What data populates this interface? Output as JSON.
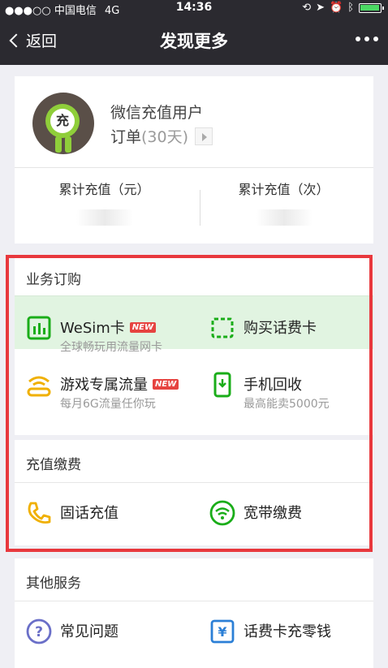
{
  "status_bar": {
    "carrier": "●●●○○ 中国电信",
    "network": "4G",
    "time": "14:36"
  },
  "nav": {
    "back_label": "返回",
    "title": "发现更多"
  },
  "profile": {
    "avatar_char": "充",
    "name": "微信充值用户",
    "order_label": "订单",
    "order_days": "(30天)",
    "stat_amount_label": "累计充值（元）",
    "stat_count_label": "累计充值（次）"
  },
  "sections": {
    "business": {
      "title": "业务订购",
      "items": [
        {
          "label": "WeSim卡",
          "badge": "NEW",
          "sub": "全球畅玩用流量网卡",
          "icon": "bar-chart-icon",
          "color": "#1aad19"
        },
        {
          "label": "购买话费卡",
          "sub": "",
          "icon": "card-icon",
          "color": "#1aad19"
        },
        {
          "label": "游戏专属流量",
          "badge": "NEW",
          "sub": "每月6G流量任你玩",
          "icon": "game-pad-icon",
          "color": "#f0b000"
        },
        {
          "label": "手机回收",
          "sub": "最高能卖5000元",
          "icon": "phone-recycle-icon",
          "color": "#1aad19"
        }
      ]
    },
    "recharge": {
      "title": "充值缴费",
      "items": [
        {
          "label": "固话充值",
          "icon": "telephone-icon",
          "color": "#f0b000"
        },
        {
          "label": "宽带缴费",
          "icon": "wifi-icon",
          "color": "#1aad19"
        }
      ]
    },
    "other": {
      "title": "其他服务",
      "items": [
        {
          "label": "常见问题",
          "icon": "question-icon",
          "color": "#6a6fc8"
        },
        {
          "label": "话费卡充零钱",
          "icon": "yuan-card-icon",
          "color": "#2b7fd6"
        }
      ]
    }
  },
  "colors": {
    "nav_bg": "#2b2a30",
    "highlight_border": "#e8383d",
    "badge": "#e64340",
    "page_bg": "#efeff4"
  }
}
